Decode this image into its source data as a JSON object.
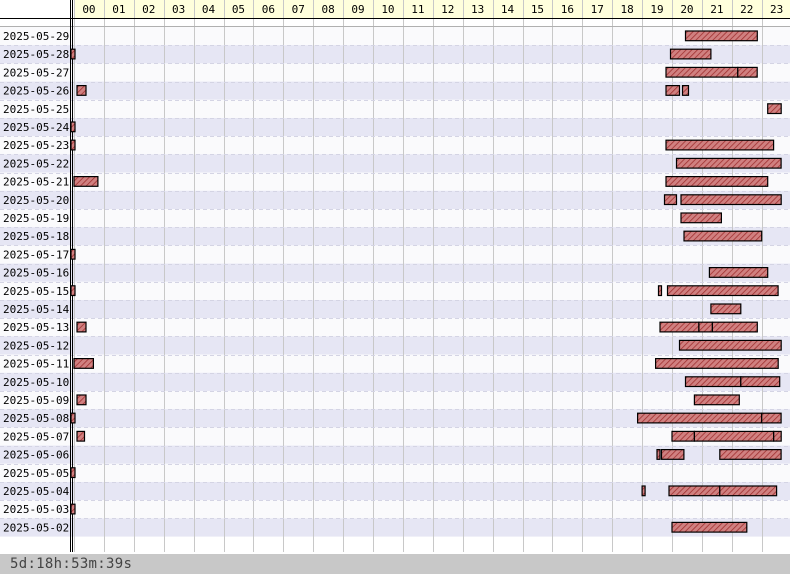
{
  "chart_data": {
    "type": "timeline",
    "x_unit": "hour of day",
    "hour_labels": [
      "00",
      "01",
      "02",
      "03",
      "04",
      "05",
      "06",
      "07",
      "08",
      "09",
      "10",
      "11",
      "12",
      "13",
      "14",
      "15",
      "16",
      "17",
      "18",
      "19",
      "20",
      "21",
      "22",
      "23"
    ],
    "rows": [
      {
        "date": "2025-05-29",
        "intervals": [
          [
            20.45,
            22.85
          ]
        ]
      },
      {
        "date": "2025-05-28",
        "intervals": [
          [
            0.0,
            0.1
          ],
          [
            19.95,
            21.3
          ]
        ]
      },
      {
        "date": "2025-05-27",
        "intervals": [
          [
            19.8,
            22.2
          ],
          [
            22.2,
            22.85
          ]
        ]
      },
      {
        "date": "2025-05-26",
        "intervals": [
          [
            0.1,
            0.4
          ],
          [
            19.8,
            20.25
          ],
          [
            20.35,
            20.55
          ]
        ]
      },
      {
        "date": "2025-05-25",
        "intervals": [
          [
            23.2,
            23.65
          ]
        ]
      },
      {
        "date": "2025-05-24",
        "intervals": [
          [
            0.0,
            0.1
          ]
        ]
      },
      {
        "date": "2025-05-23",
        "intervals": [
          [
            0.0,
            0.1
          ],
          [
            19.8,
            23.4
          ]
        ]
      },
      {
        "date": "2025-05-22",
        "intervals": [
          [
            20.15,
            23.65
          ]
        ]
      },
      {
        "date": "2025-05-21",
        "intervals": [
          [
            0.0,
            0.8
          ],
          [
            19.8,
            23.2
          ]
        ]
      },
      {
        "date": "2025-05-20",
        "intervals": [
          [
            19.75,
            20.15
          ],
          [
            20.3,
            23.65
          ]
        ]
      },
      {
        "date": "2025-05-19",
        "intervals": [
          [
            20.3,
            21.65
          ]
        ]
      },
      {
        "date": "2025-05-18",
        "intervals": [
          [
            20.4,
            23.0
          ]
        ]
      },
      {
        "date": "2025-05-17",
        "intervals": [
          [
            0.0,
            0.1
          ]
        ]
      },
      {
        "date": "2025-05-16",
        "intervals": [
          [
            21.25,
            23.2
          ]
        ]
      },
      {
        "date": "2025-05-15",
        "intervals": [
          [
            0.0,
            0.1
          ],
          [
            19.55,
            19.65
          ],
          [
            19.85,
            23.55
          ]
        ]
      },
      {
        "date": "2025-05-14",
        "intervals": [
          [
            21.3,
            22.3
          ]
        ]
      },
      {
        "date": "2025-05-13",
        "intervals": [
          [
            0.1,
            0.4
          ],
          [
            19.6,
            20.9
          ],
          [
            20.9,
            21.35
          ],
          [
            21.35,
            22.85
          ]
        ]
      },
      {
        "date": "2025-05-12",
        "intervals": [
          [
            20.25,
            23.65
          ]
        ]
      },
      {
        "date": "2025-05-11",
        "intervals": [
          [
            0.0,
            0.65
          ],
          [
            19.45,
            23.55
          ]
        ]
      },
      {
        "date": "2025-05-10",
        "intervals": [
          [
            20.45,
            22.3
          ],
          [
            22.3,
            23.6
          ]
        ]
      },
      {
        "date": "2025-05-09",
        "intervals": [
          [
            0.1,
            0.4
          ],
          [
            20.75,
            22.25
          ]
        ]
      },
      {
        "date": "2025-05-08",
        "intervals": [
          [
            0.0,
            0.1
          ],
          [
            18.85,
            23.0
          ],
          [
            23.0,
            23.65
          ]
        ]
      },
      {
        "date": "2025-05-07",
        "intervals": [
          [
            0.1,
            0.35
          ],
          [
            20.0,
            20.75
          ],
          [
            20.75,
            23.4
          ],
          [
            23.4,
            23.65
          ]
        ]
      },
      {
        "date": "2025-05-06",
        "intervals": [
          [
            19.5,
            19.6
          ],
          [
            19.65,
            20.4
          ],
          [
            21.6,
            23.65
          ]
        ]
      },
      {
        "date": "2025-05-05",
        "intervals": [
          [
            0.0,
            0.1
          ]
        ]
      },
      {
        "date": "2025-05-04",
        "intervals": [
          [
            19.0,
            19.1
          ],
          [
            19.9,
            21.6
          ],
          [
            21.6,
            23.5
          ]
        ]
      },
      {
        "date": "2025-05-03",
        "intervals": [
          [
            0.0,
            0.1
          ]
        ]
      },
      {
        "date": "2025-05-02",
        "intervals": [
          [
            20.0,
            22.5
          ]
        ]
      }
    ],
    "total_label": "5d:18h:53m:39s",
    "colors": {
      "bar_fill": "#d08080",
      "bar_hatch": "#a03030",
      "bar_border": "#000000",
      "row_band": "#e6e6f4",
      "row_plain": "#fafafc",
      "header_bg": "#ffffdc",
      "grid": "#c8c8c8",
      "footer_bg": "#c8c8c8"
    }
  }
}
